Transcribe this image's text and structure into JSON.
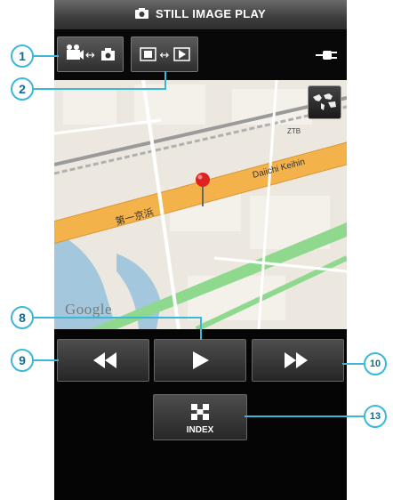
{
  "header": {
    "title": "STILL IMAGE PLAY",
    "icon": "camera-icon"
  },
  "toolbar": {
    "mode_toggle_icon": "video-still-toggle-icon",
    "slideshow_toggle_icon": "slideshow-toggle-icon",
    "battery_icon": "power-plug-icon"
  },
  "map": {
    "attribution": "Google",
    "world_button_icon": "world-map-icon",
    "labels": {
      "road_left": "第一京浜",
      "road_right": "Daiichi Keihin",
      "station": "ZTB"
    }
  },
  "controls": {
    "rewind_icon": "rewind-icon",
    "play_icon": "play-icon",
    "forward_icon": "fast-forward-icon",
    "index_label": "INDEX",
    "index_icon": "index-grid-icon"
  },
  "callouts": [
    "1",
    "2",
    "8",
    "9",
    "10",
    "13"
  ],
  "colors": {
    "accent": "#3bb8d8",
    "road": "#f4b24a",
    "green_line": "#7cd37c",
    "water": "#9fc7dc"
  }
}
